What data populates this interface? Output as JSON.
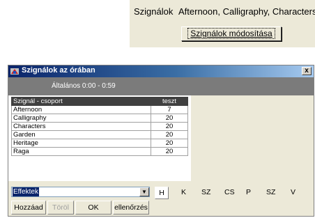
{
  "top": {
    "label": "Szignálok",
    "value": "Afternoon, Calligraphy, Characters",
    "button_label": "Szignálok módosítása"
  },
  "window": {
    "title": "Szignálok az órában",
    "close_label": "x",
    "summary": "Általános  0:00 - 0:59",
    "columns": [
      "Szignál - csoport",
      "teszt"
    ],
    "rows": [
      {
        "name": "Afternoon",
        "value": "7"
      },
      {
        "name": "Calligraphy",
        "value": "20"
      },
      {
        "name": "Characters",
        "value": "20"
      },
      {
        "name": "Garden",
        "value": "20"
      },
      {
        "name": "Heritage",
        "value": "20"
      },
      {
        "name": "Raga",
        "value": "20"
      }
    ],
    "combo_value": "Effektek",
    "letters": [
      "H",
      "K",
      "SZ",
      "CS",
      "P",
      "SZ",
      "V"
    ],
    "buttons": {
      "add": "Hozzáad",
      "delete": "Töröl",
      "ok": "OK",
      "check": "ellenőrzés"
    }
  },
  "colors": {
    "title_gradient_start": "#0a246a",
    "summary_bar": "#7b7b7b",
    "header_row": "#404040"
  }
}
